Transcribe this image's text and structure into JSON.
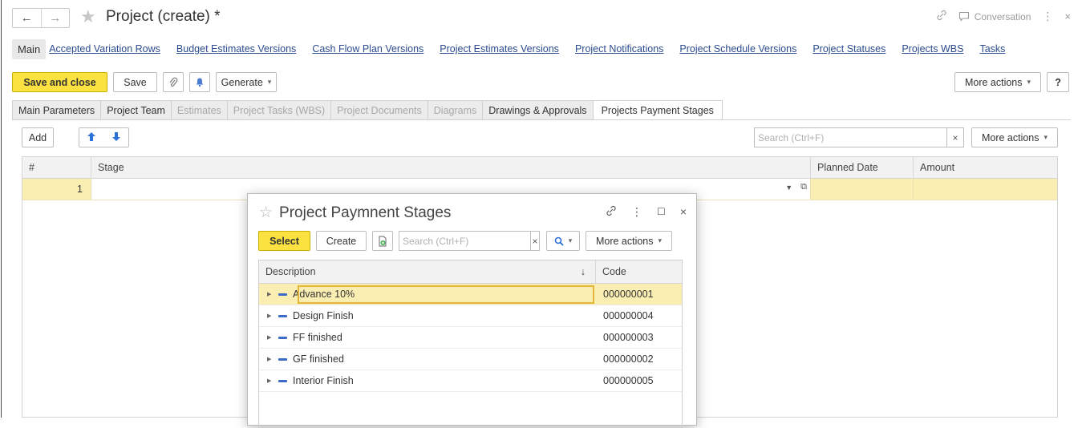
{
  "window": {
    "title": "Project (create) *",
    "conversation_label": "Conversation"
  },
  "links": {
    "main": "Main",
    "items": [
      "Accepted Variation Rows",
      "Budget Estimates Versions",
      "Cash Flow Plan Versions",
      "Project Estimates Versions",
      "Project Notifications",
      "Project Schedule Versions",
      "Project Statuses",
      "Projects WBS",
      "Tasks"
    ]
  },
  "toolbar": {
    "save_close": "Save and close",
    "save": "Save",
    "generate": "Generate",
    "more_actions": "More actions",
    "help": "?"
  },
  "tabs": [
    {
      "label": "Main Parameters",
      "state": "normal"
    },
    {
      "label": "Project Team",
      "state": "normal"
    },
    {
      "label": "Estimates",
      "state": "disabled"
    },
    {
      "label": "Project Tasks (WBS)",
      "state": "disabled"
    },
    {
      "label": "Project Documents",
      "state": "disabled"
    },
    {
      "label": "Diagrams",
      "state": "disabled"
    },
    {
      "label": "Drawings & Approvals",
      "state": "normal"
    },
    {
      "label": "Projects Payment Stages",
      "state": "active"
    }
  ],
  "stages_toolbar": {
    "add": "Add",
    "search_placeholder": "Search (Ctrl+F)",
    "clear": "×",
    "more_actions": "More actions"
  },
  "stages_table": {
    "columns": [
      "#",
      "Stage",
      "Planned Date",
      "Amount"
    ],
    "rows": [
      {
        "num": "1",
        "stage": "",
        "planned_date": "",
        "amount": ""
      }
    ]
  },
  "popup": {
    "title": "Project Paymnent Stages",
    "select": "Select",
    "create": "Create",
    "search_placeholder": "Search (Ctrl+F)",
    "clear": "×",
    "more_actions": "More actions",
    "columns": {
      "description": "Description",
      "sort": "↓",
      "code": "Code"
    },
    "rows": [
      {
        "description": "Advance 10%",
        "code": "000000001"
      },
      {
        "description": "Design Finish",
        "code": "000000004"
      },
      {
        "description": "FF finished",
        "code": "000000003"
      },
      {
        "description": "GF finished",
        "code": "000000002"
      },
      {
        "description": "Interior Finish",
        "code": "000000005"
      }
    ]
  }
}
